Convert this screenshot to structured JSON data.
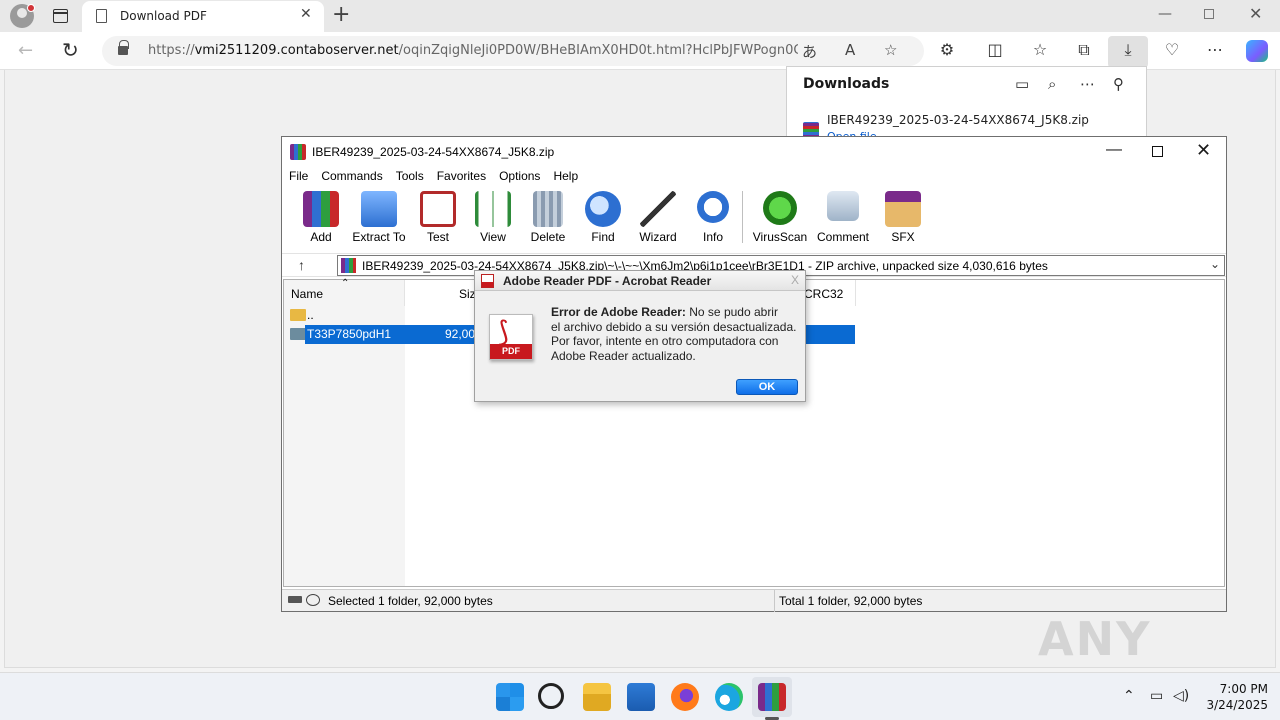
{
  "browser": {
    "tab_title": "Download PDF",
    "url_prefix": "https://",
    "url_host": "vmi2511209.contaboserver.net",
    "url_path": "/oqinZqigNleJi0PD0W/BHeBIAmX0HD0t.html?HclPbJFWPogn0C...",
    "icons": [
      "profile-icon",
      "tab-actions-icon",
      "page-icon",
      "close-icon",
      "plus-icon",
      "back-icon",
      "refresh-icon",
      "lock-icon",
      "translate-icon",
      "read-aloud-icon",
      "favorite-icon",
      "extensions-icon",
      "split-screen-icon",
      "favorites-icon",
      "collections-icon",
      "downloads-icon",
      "performance-icon",
      "more-icon",
      "copilot-icon"
    ]
  },
  "downloads": {
    "title": "Downloads",
    "item_name": "IBER49239_2025-03-24-54XX8674_J5K8.zip",
    "item_link": "Open file"
  },
  "winrar": {
    "title": "IBER49239_2025-03-24-54XX8674_J5K8.zip",
    "menu": [
      "File",
      "Commands",
      "Tools",
      "Favorites",
      "Options",
      "Help"
    ],
    "toolbar": {
      "add": "Add",
      "extract": "Extract To",
      "test": "Test",
      "view": "View",
      "delete": "Delete",
      "find": "Find",
      "wizard": "Wizard",
      "info": "Info",
      "virusscan": "VirusScan",
      "comment": "Comment",
      "sfx": "SFX"
    },
    "address": "IBER49239_2025-03-24-54XX8674_J5K8.zip\\~\\-\\~~\\Xm6Jm2\\p6j1p1cee\\rBr3E1D1 - ZIP archive, unpacked size 4,030,616 bytes",
    "columns": {
      "name": "Name",
      "size": "Size",
      "crc": "CRC32"
    },
    "rows": [
      {
        "name": "..",
        "size": ""
      },
      {
        "name": "T33P7850pdH1",
        "size": "92,000"
      }
    ],
    "status_left": "Selected 1 folder, 92,000 bytes",
    "status_right": "Total 1 folder, 92,000 bytes"
  },
  "dialog": {
    "title": "Adobe Reader PDF - Acrobat Reader",
    "close": "X",
    "msg_bold": "Error de Adobe Reader:",
    "msg_line1": " No se pudo abrir",
    "msg_line2": "el archivo debido a su versión desactualizada.",
    "msg_line3": "Por favor, intente en otro computadora con",
    "msg_line4": "Adobe Reader actualizado.",
    "pdf_label": "PDF",
    "ok": "OK"
  },
  "watermark": "ANY RUN",
  "taskbar": {
    "time": "7:00 PM",
    "date": "3/24/2025"
  }
}
